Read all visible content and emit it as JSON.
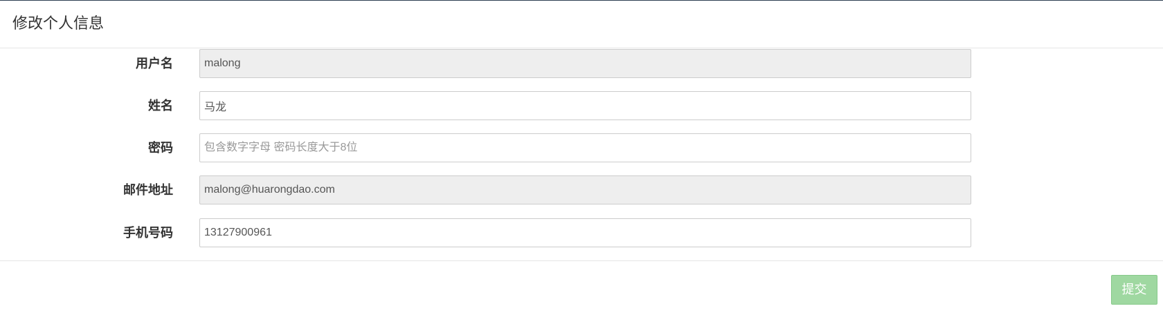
{
  "modal": {
    "title": "修改个人信息"
  },
  "form": {
    "fields": [
      {
        "label": "用户名",
        "value": "malong",
        "placeholder": "",
        "readonly": true
      },
      {
        "label": "姓名",
        "value": "马龙",
        "placeholder": "",
        "readonly": false
      },
      {
        "label": "密码",
        "value": "",
        "placeholder": "包含数字字母 密码长度大于8位",
        "readonly": false
      },
      {
        "label": "邮件地址",
        "value": "malong@huarongdao.com",
        "placeholder": "",
        "readonly": true
      },
      {
        "label": "手机号码",
        "value": "13127900961",
        "placeholder": "",
        "readonly": false
      }
    ]
  },
  "footer": {
    "submit_label": "提交"
  },
  "colors": {
    "submit_button": "#9fd8a1",
    "readonly_input": "#eeeeee",
    "header_border": "#2c3e50"
  }
}
